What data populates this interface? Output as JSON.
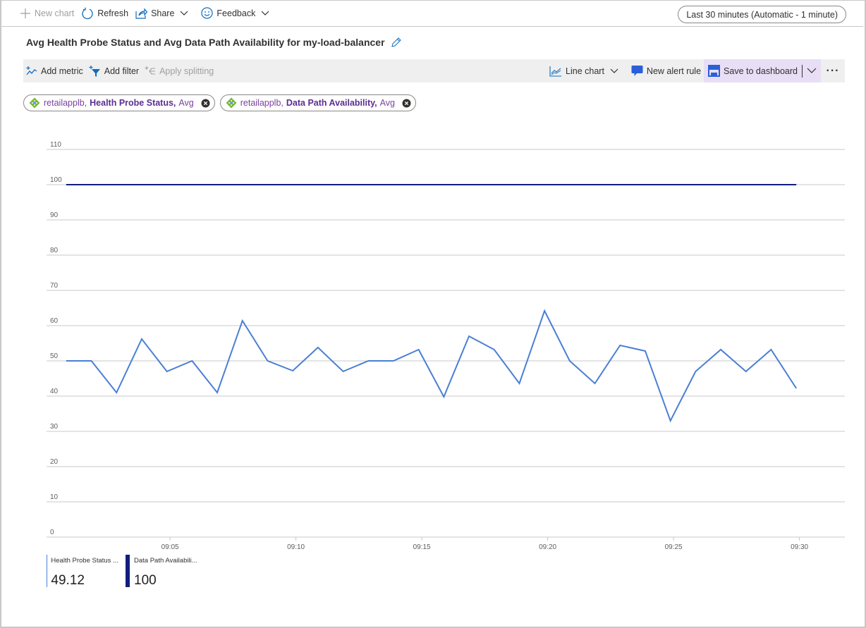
{
  "toolbar": {
    "new_chart": "New chart",
    "refresh": "Refresh",
    "share": "Share",
    "feedback": "Feedback",
    "time_range": "Last 30 minutes (Automatic - 1 minute)"
  },
  "chart_title": "Avg Health Probe Status and Avg Data Path Availability for my-load-balancer",
  "commands": {
    "add_metric": "Add metric",
    "add_filter": "Add filter",
    "apply_splitting": "Apply splitting",
    "chart_type": "Line chart",
    "new_alert_rule": "New alert rule",
    "save_to_dashboard": "Save to dashboard",
    "more": "···"
  },
  "metric_chips": [
    {
      "resource": "retailapplb,",
      "metric": "Health Probe Status,",
      "aggregation": "Avg"
    },
    {
      "resource": "retailapplb,",
      "metric": "Data Path Availability,",
      "aggregation": "Avg"
    }
  ],
  "legend": [
    {
      "name": "Health Probe Status ...",
      "value": "49.12",
      "color": "#4a7fd4"
    },
    {
      "name": "Data Path Availabili...",
      "value": "100",
      "color": "#111d7e"
    }
  ],
  "chart_data": {
    "type": "line",
    "title": "Avg Health Probe Status and Avg Data Path Availability for my-load-balancer",
    "xlabel": "",
    "ylabel": "",
    "ylim": [
      0,
      110
    ],
    "yticks": [
      0,
      10,
      20,
      30,
      40,
      50,
      60,
      70,
      80,
      90,
      100,
      110
    ],
    "x_minutes_range": [
      0,
      30.5
    ],
    "xticks": [
      {
        "minute": 4.625,
        "label": "09:05"
      },
      {
        "minute": 9.625,
        "label": "09:10"
      },
      {
        "minute": 14.625,
        "label": "09:15"
      },
      {
        "minute": 19.625,
        "label": "09:20"
      },
      {
        "minute": 24.625,
        "label": "09:25"
      },
      {
        "minute": 29.625,
        "label": "09:30"
      }
    ],
    "x": [
      0.5,
      1.5,
      2.5,
      3.5,
      4.5,
      5.5,
      6.5,
      7.5,
      8.5,
      9.5,
      10.5,
      11.5,
      12.5,
      13.5,
      14.5,
      15.5,
      16.5,
      17.5,
      18.5,
      19.5,
      20.5,
      21.5,
      22.5,
      23.5,
      24.5,
      25.5,
      26.5,
      27.5,
      28.5,
      29.5
    ],
    "grid": true,
    "legend_position": "bottom-left",
    "series": [
      {
        "name": "Health Probe Status, Avg",
        "color": "#4a7fd4",
        "values": [
          50,
          50,
          41,
          56.2,
          47,
          50,
          41,
          61.4,
          50,
          47.2,
          53.8,
          47,
          50,
          50,
          53.2,
          39.8,
          57,
          53.2,
          43.6,
          64.2,
          50,
          43.6,
          54.4,
          52.8,
          33,
          47,
          53.2,
          47,
          53.2,
          42.2
        ]
      },
      {
        "name": "Data Path Availability, Avg",
        "color": "#111d7e",
        "values": [
          100,
          100,
          100,
          100,
          100,
          100,
          100,
          100,
          100,
          100,
          100,
          100,
          100,
          100,
          100,
          100,
          100,
          100,
          100,
          100,
          100,
          100,
          100,
          100,
          100,
          100,
          100,
          100,
          100,
          100
        ]
      }
    ]
  }
}
